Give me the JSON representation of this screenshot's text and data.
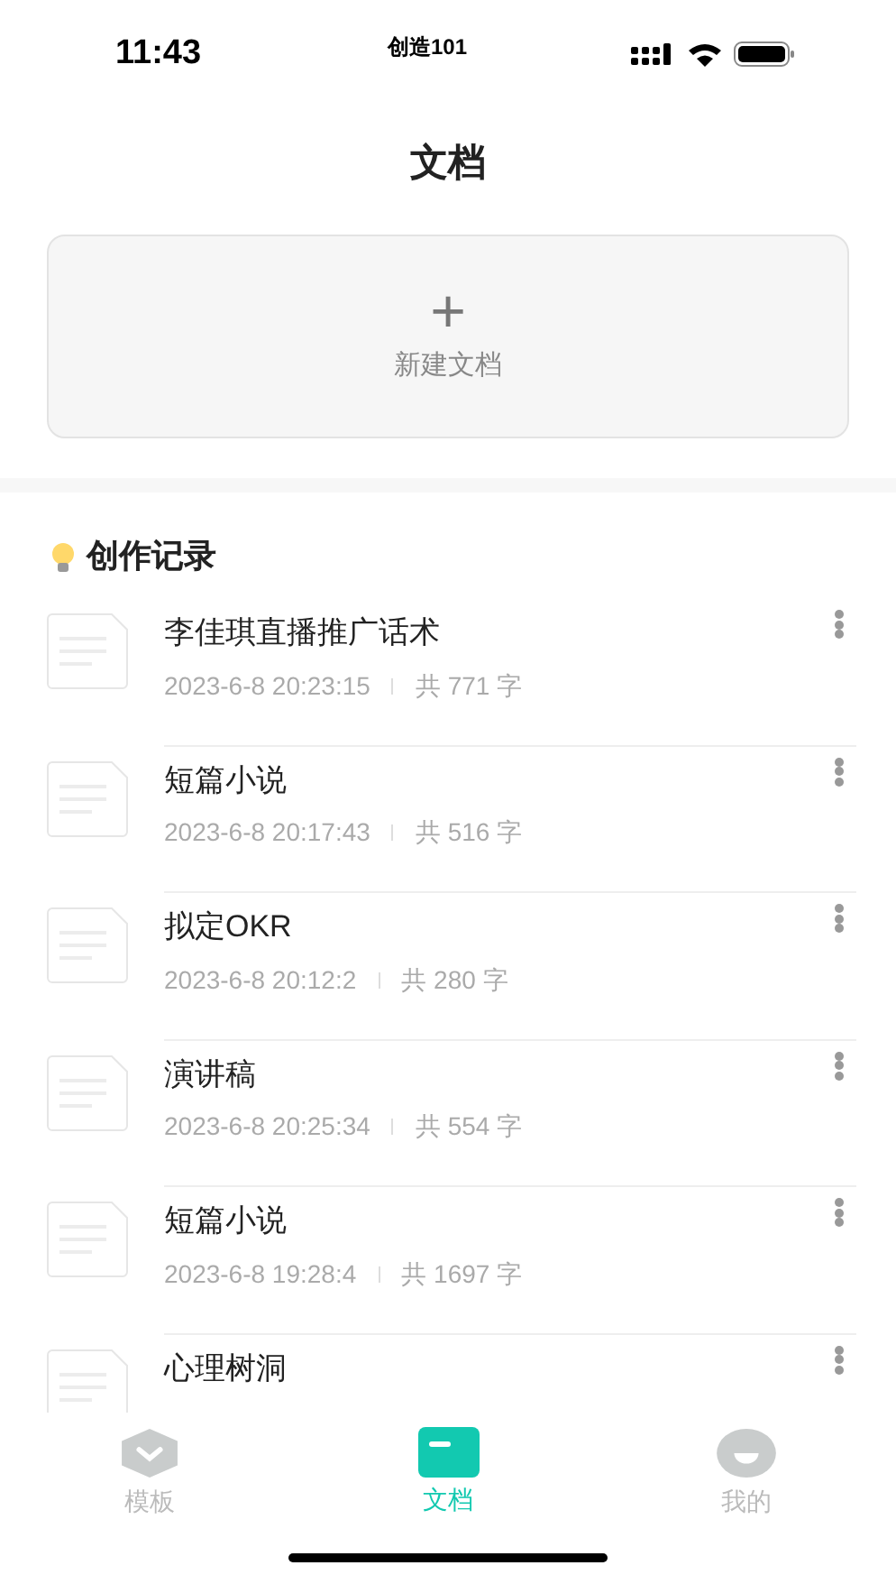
{
  "status_bar": {
    "time": "11:43",
    "carrier": "创造101"
  },
  "title": "文档",
  "new_doc": {
    "icon": "+",
    "label": "新建文档"
  },
  "section": {
    "title": "创作记录"
  },
  "documents": [
    {
      "title": "李佳琪直播推广话术",
      "date": "2023-6-8 20:23:15",
      "count": "共 771 字"
    },
    {
      "title": "短篇小说",
      "date": "2023-6-8 20:17:43",
      "count": "共 516 字"
    },
    {
      "title": "拟定OKR",
      "date": "2023-6-8 20:12:2",
      "count": "共 280 字"
    },
    {
      "title": "演讲稿",
      "date": "2023-6-8 20:25:34",
      "count": "共 554 字"
    },
    {
      "title": "短篇小说",
      "date": "2023-6-8 19:28:4",
      "count": "共 1697 字"
    },
    {
      "title": "心理树洞"
    }
  ],
  "tabs": [
    {
      "kind": "template",
      "label": "模板",
      "selected": false
    },
    {
      "kind": "docs",
      "label": "文档",
      "selected": true
    },
    {
      "kind": "profile",
      "label": "我的",
      "selected": false
    }
  ]
}
